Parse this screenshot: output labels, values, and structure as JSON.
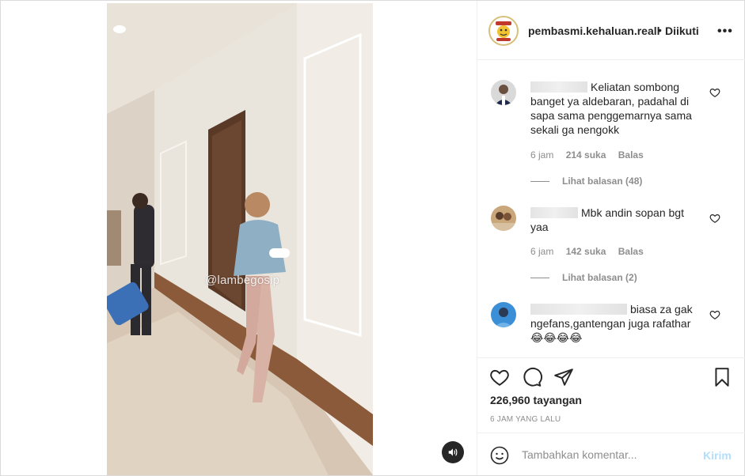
{
  "header": {
    "username": "pembasmi.kehaluan.reall",
    "separator": "•",
    "follow_label": "Diikuti",
    "more_label": "•••"
  },
  "video": {
    "watermark": "@lambegosip",
    "sound_icon": "speaker-icon"
  },
  "comments": [
    {
      "text": "Keliatan sombong banget ya aldebaran, padahal di sapa sama penggemarnya sama sekali ga nengokk",
      "time": "6 jam",
      "likes": "214 suka",
      "reply": "Balas",
      "view_replies": "Lihat balasan (48)"
    },
    {
      "text": "Mbk andin sopan bgt yaa",
      "time": "6 jam",
      "likes": "142 suka",
      "reply": "Balas",
      "view_replies": "Lihat balasan (2)"
    },
    {
      "text": "biasa za gak ngefans,gantengan juga rafathar",
      "emojis": "😂😂😂😂"
    }
  ],
  "actions": {
    "views": "226,960 tayangan",
    "time_ago": "6 JAM YANG LALU"
  },
  "add_comment": {
    "placeholder": "Tambahkan komentar...",
    "post_label": "Kirim"
  },
  "colors": {
    "text": "#262626",
    "muted": "#8e8e8e",
    "border": "#efefef",
    "post_disabled": "#b2dffc"
  }
}
